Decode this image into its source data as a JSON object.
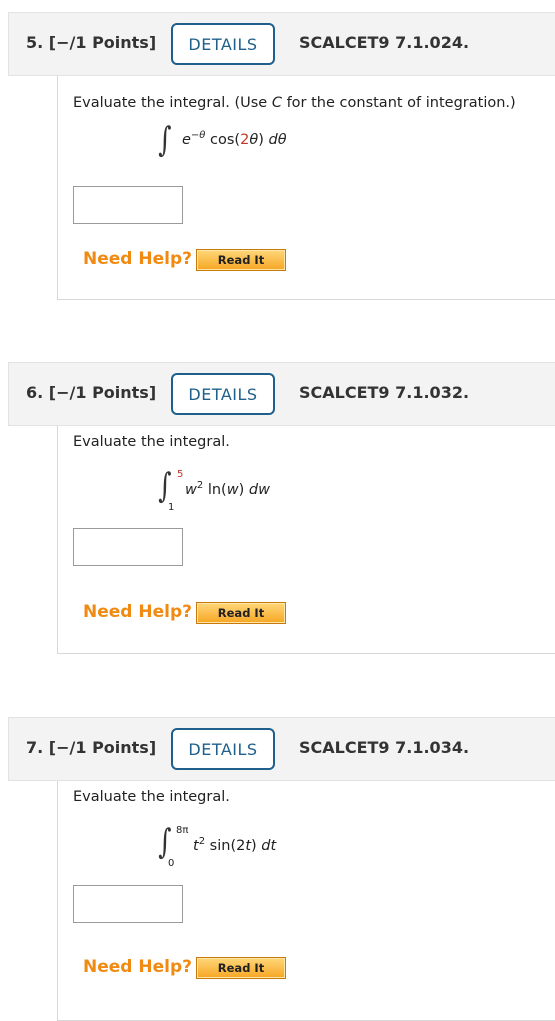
{
  "questions": [
    {
      "number": "5.",
      "points": "[−/1 Points]",
      "details_label": "DETAILS",
      "code": "SCALCET9 7.1.024.",
      "prompt_prefix": "Evaluate the integral. (Use ",
      "prompt_var": "C",
      "prompt_suffix": " for the constant of integration.)",
      "integral": {
        "lower": "",
        "upper": "",
        "e": "e",
        "exp": "−θ",
        "fn_open": " cos(",
        "coef": "2",
        "fn_var": "θ",
        "fn_close": ") ",
        "d": "dθ"
      },
      "answer_value": "",
      "need_help": "Need Help?",
      "read_it": "Read It"
    },
    {
      "number": "6.",
      "points": "[−/1 Points]",
      "details_label": "DETAILS",
      "code": "SCALCET9 7.1.032.",
      "prompt": "Evaluate the integral.",
      "integral": {
        "lower": "1",
        "upper": "5",
        "base": "w",
        "exp": "2",
        "fn": " ln(",
        "fn_var": "w",
        "fn_close": ") ",
        "d": "dw"
      },
      "answer_value": "",
      "need_help": "Need Help?",
      "read_it": "Read It"
    },
    {
      "number": "7.",
      "points": "[−/1 Points]",
      "details_label": "DETAILS",
      "code": "SCALCET9 7.1.034.",
      "prompt": "Evaluate the integral.",
      "integral": {
        "lower": "0",
        "upper": "8π",
        "base": "t",
        "exp": "2",
        "fn": " sin(2",
        "fn_var": "t",
        "fn_close": ") ",
        "d": "dt"
      },
      "answer_value": "",
      "need_help": "Need Help?",
      "read_it": "Read It"
    }
  ],
  "colors": {
    "details_blue": "#1f5f8b",
    "help_orange": "#f08a12",
    "accent_red": "#c0392b",
    "header_bg": "#f3f3f3"
  }
}
